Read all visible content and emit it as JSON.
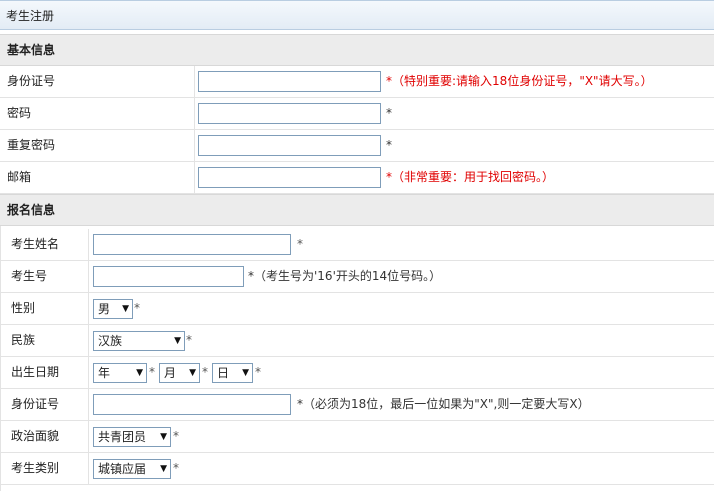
{
  "window": {
    "title": "考生注册"
  },
  "sections": {
    "basic": "基本信息",
    "apply": "报名信息"
  },
  "basic": {
    "id_label": "身份证号",
    "id_note": "*（特别重要:请输入18位身份证号，\"X\"请大写。）",
    "pwd_label": "密码",
    "pwd_note": "*",
    "repwd_label": "重复密码",
    "repwd_note": "*",
    "email_label": "邮箱",
    "email_note": "*（非常重要：用于找回密码。）"
  },
  "apply": {
    "name_label": "考生姓名",
    "name_note": "*",
    "exam_no_label": "考生号",
    "exam_no_note": "*（考生号为'16'开头的14位号码。）",
    "gender_label": "性别",
    "gender_value": "男",
    "gender_note": "*",
    "ethnic_label": "民族",
    "ethnic_value": "汉族",
    "ethnic_note": "*",
    "birth_label": "出生日期",
    "birth_year": "年",
    "birth_month": "月",
    "birth_day": "日",
    "star": "*",
    "id_label": "身份证号",
    "id_note": "*（必须为18位，最后一位如果为\"X\",则一定要大写X）",
    "political_label": "政治面貌",
    "political_value": "共青团员",
    "political_note": "*",
    "type_label": "考生类别",
    "type_value": "城镇应届",
    "type_note": "*"
  },
  "icons": {
    "dropdown": "chevron-down-icon"
  }
}
